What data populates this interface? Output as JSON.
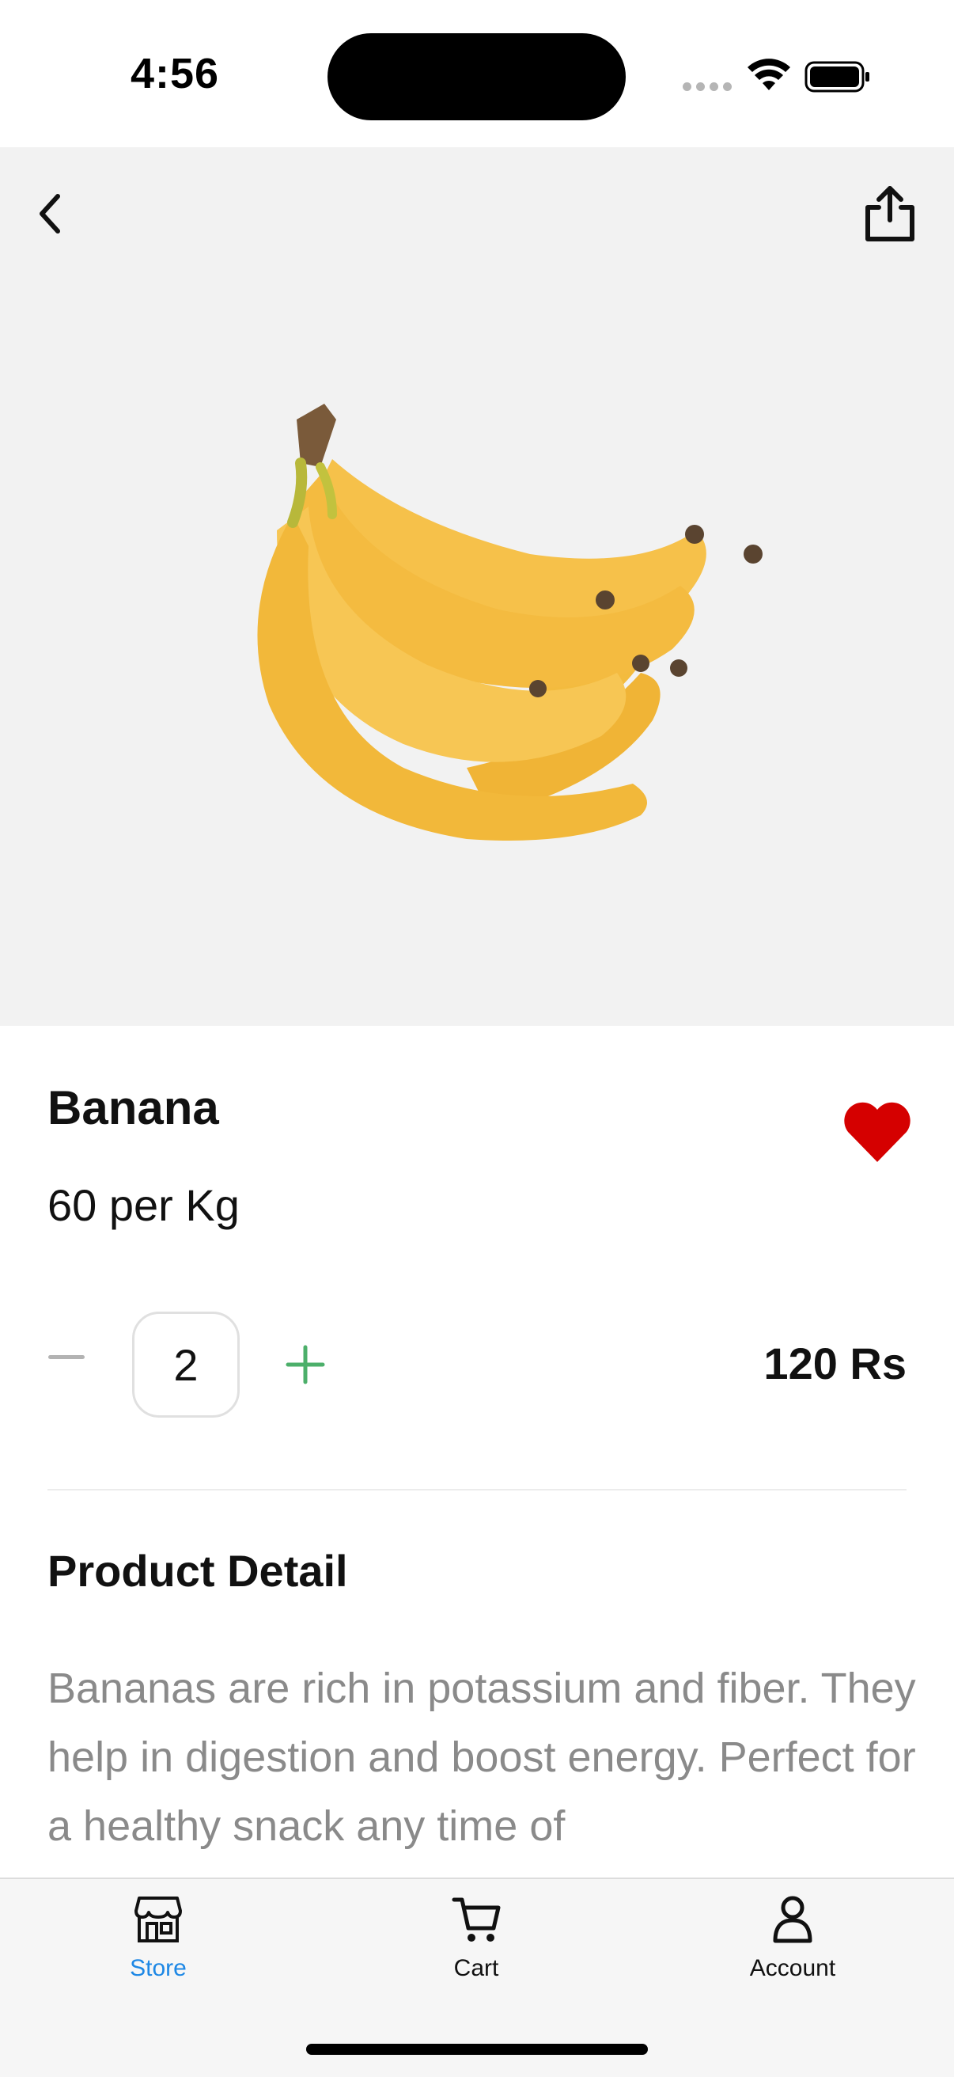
{
  "status_bar": {
    "time": "4:56"
  },
  "header": {
    "back_icon": "chevron-left-icon",
    "share_icon": "share-icon"
  },
  "product": {
    "name": "Banana",
    "unit_price": "60 per Kg",
    "favorite": true,
    "favorite_color": "#d50000",
    "quantity": "2",
    "total_price": "120 Rs",
    "plus_color": "#4caf6a",
    "minus_color": "#b3b3b3"
  },
  "detail": {
    "title": "Product Detail",
    "text": "Bananas are rich in potassium and fiber. They help in digestion and boost energy. Perfect for a healthy snack any time of"
  },
  "tabs": [
    {
      "label": "Store",
      "icon": "store-icon",
      "active": true
    },
    {
      "label": "Cart",
      "icon": "cart-icon",
      "active": false
    },
    {
      "label": "Account",
      "icon": "account-icon",
      "active": false
    }
  ],
  "colors": {
    "accent": "#1e88e5",
    "hero_background": "#f2f2f2"
  }
}
